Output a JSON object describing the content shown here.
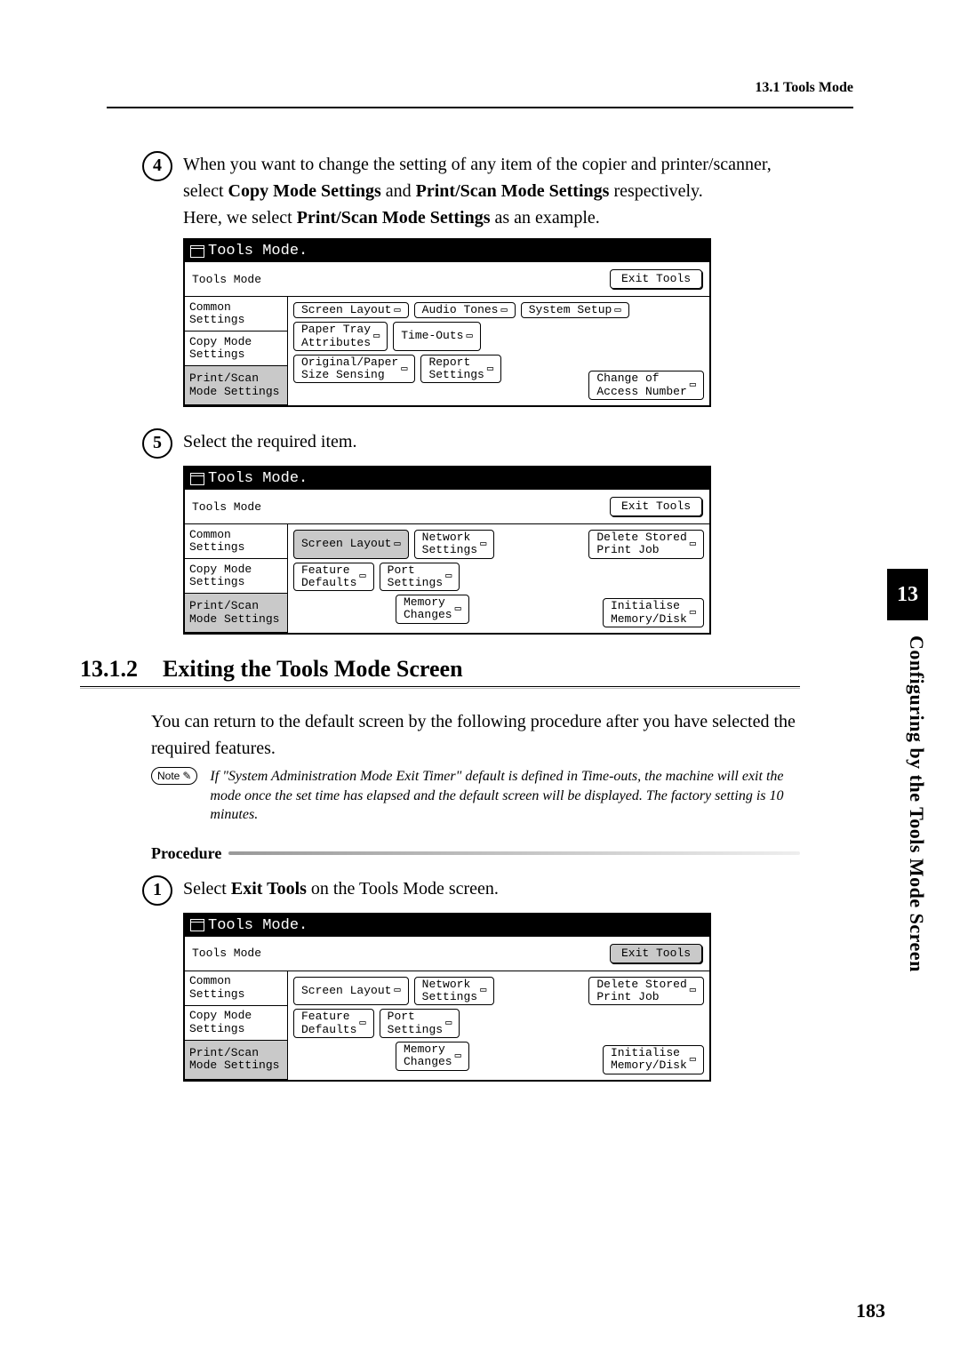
{
  "header": "13.1 Tools Mode",
  "side_tab": "13",
  "side_label": "Configuring by the Tools Mode Screen",
  "page_number": "183",
  "step4": {
    "num": "4",
    "text_prefix": "When you want to change the setting of any item of the copier and printer/scanner, select ",
    "bold1": "Copy Mode Settings",
    "mid": " and ",
    "bold2": "Print/Scan Mode Settings",
    "suffix": " respectively.",
    "line2_prefix": "Here, we select ",
    "line2_bold": "Print/Scan Mode Settings",
    "line2_suffix": " as an example."
  },
  "screenshot1": {
    "title": "Tools Mode.",
    "breadcrumb": "Tools Mode",
    "exit": "Exit Tools",
    "tabs": [
      "Common\nSettings",
      "Copy Mode\nSettings",
      "Print/Scan\nMode Settings"
    ],
    "selected_tab": 2,
    "row1": [
      "Screen Layout",
      "Audio Tones",
      "System Setup"
    ],
    "row2": [
      [
        "Paper Tray",
        "Attributes"
      ],
      "Time-Outs"
    ],
    "row3": [
      [
        "Original/Paper",
        "Size Sensing"
      ],
      [
        "Report",
        "Settings"
      ]
    ],
    "right_btn": [
      "Change of",
      "Access Number"
    ]
  },
  "step5": {
    "num": "5",
    "text": "Select the required item."
  },
  "screenshot2": {
    "title": "Tools Mode.",
    "breadcrumb": "Tools Mode",
    "exit": "Exit Tools",
    "tabs": [
      "Common\nSettings",
      "Copy Mode\nSettings",
      "Print/Scan\nMode Settings"
    ],
    "selected_tab": 2,
    "row1a": "Screen Layout",
    "row1b": [
      "Network",
      "Settings"
    ],
    "right1": [
      "Delete Stored",
      "Print Job"
    ],
    "row2a": [
      "Feature",
      "Defaults"
    ],
    "row2b": [
      "Port",
      "Settings"
    ],
    "row3b": [
      "Memory",
      "Changes"
    ],
    "right3": [
      "Initialise",
      "Memory/Disk"
    ]
  },
  "section": {
    "number": "13.1.2",
    "title": "Exiting the Tools Mode Screen",
    "body": "You can return to the default screen by the following procedure after you have selected the required features.",
    "note_label": "Note",
    "note_text": "If \"System Administration Mode Exit Timer\" default is defined in Time-outs, the machine will exit the mode once the set time has elapsed and the default screen will be displayed. The factory setting is 10 minutes.",
    "procedure": "Procedure"
  },
  "step1b": {
    "num": "1",
    "prefix": "Select ",
    "bold": "Exit Tools",
    "suffix": " on the Tools Mode screen."
  },
  "screenshot3": {
    "title": "Tools Mode.",
    "breadcrumb": "Tools Mode",
    "exit": "Exit Tools",
    "tabs": [
      "Common\nSettings",
      "Copy Mode\nSettings",
      "Print/Scan\nMode Settings"
    ],
    "selected_tab": 2,
    "row1a": "Screen Layout",
    "row1b": [
      "Network",
      "Settings"
    ],
    "right1": [
      "Delete Stored",
      "Print Job"
    ],
    "row2a": [
      "Feature",
      "Defaults"
    ],
    "row2b": [
      "Port",
      "Settings"
    ],
    "row3b": [
      "Memory",
      "Changes"
    ],
    "right3": [
      "Initialise",
      "Memory/Disk"
    ]
  }
}
